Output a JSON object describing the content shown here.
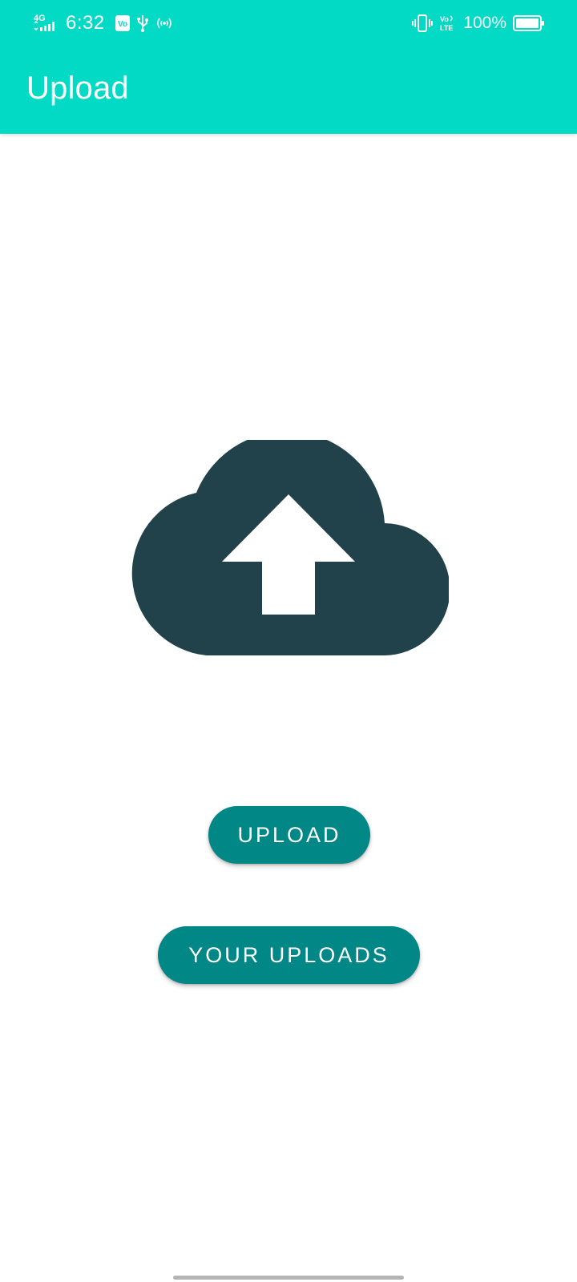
{
  "status_bar": {
    "network": "4G",
    "time": "6:32",
    "battery_percent": "100%",
    "volte": "Vo LTE",
    "icons": [
      "signal-icon",
      "sim-icon",
      "usb-icon",
      "hotspot-icon",
      "vibrate-icon",
      "volte-icon",
      "battery-icon"
    ]
  },
  "app_bar": {
    "title": "Upload"
  },
  "main": {
    "hero_icon": "cloud-upload-icon",
    "hero_color": "#21424a"
  },
  "actions": {
    "upload_label": "UPLOAD",
    "your_uploads_label": "YOUR UPLOADS"
  },
  "colors": {
    "app_bar": "#03dac5",
    "button": "#018786",
    "background": "#ffffff"
  }
}
